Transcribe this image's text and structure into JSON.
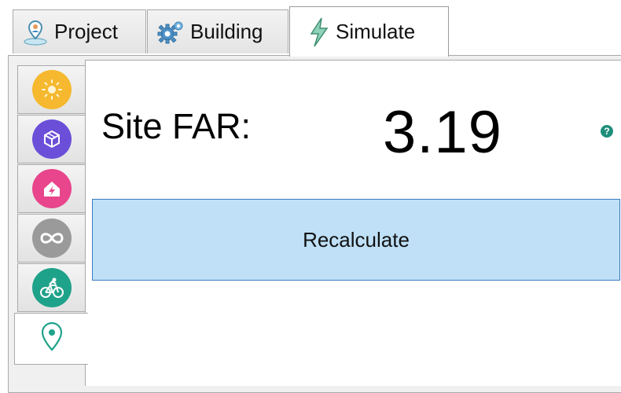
{
  "tabs": [
    {
      "label": "Project",
      "icon": "map-pin-person-icon"
    },
    {
      "label": "Building",
      "icon": "gear-icon"
    },
    {
      "label": "Simulate",
      "icon": "lightning-icon",
      "active": true
    }
  ],
  "side_tabs": [
    {
      "icon": "sun-icon",
      "color": "#f5b82e"
    },
    {
      "icon": "cube-network-icon",
      "color": "#6b4fd8"
    },
    {
      "icon": "home-energy-icon",
      "color": "#e8458c"
    },
    {
      "icon": "infinity-icon",
      "color": "#9a9a9a"
    },
    {
      "icon": "bicycle-icon",
      "color": "#1fa28a"
    },
    {
      "icon": "location-pin-icon",
      "color": "#1fa28a",
      "active": true
    }
  ],
  "main": {
    "far_label": "Site FAR:",
    "far_value": "3.19",
    "help_glyph": "?",
    "recalculate_label": "Recalculate"
  },
  "colors": {
    "accent": "#1fa28a",
    "button_fill": "#bfe0f7",
    "button_border": "#3a7bbf"
  }
}
